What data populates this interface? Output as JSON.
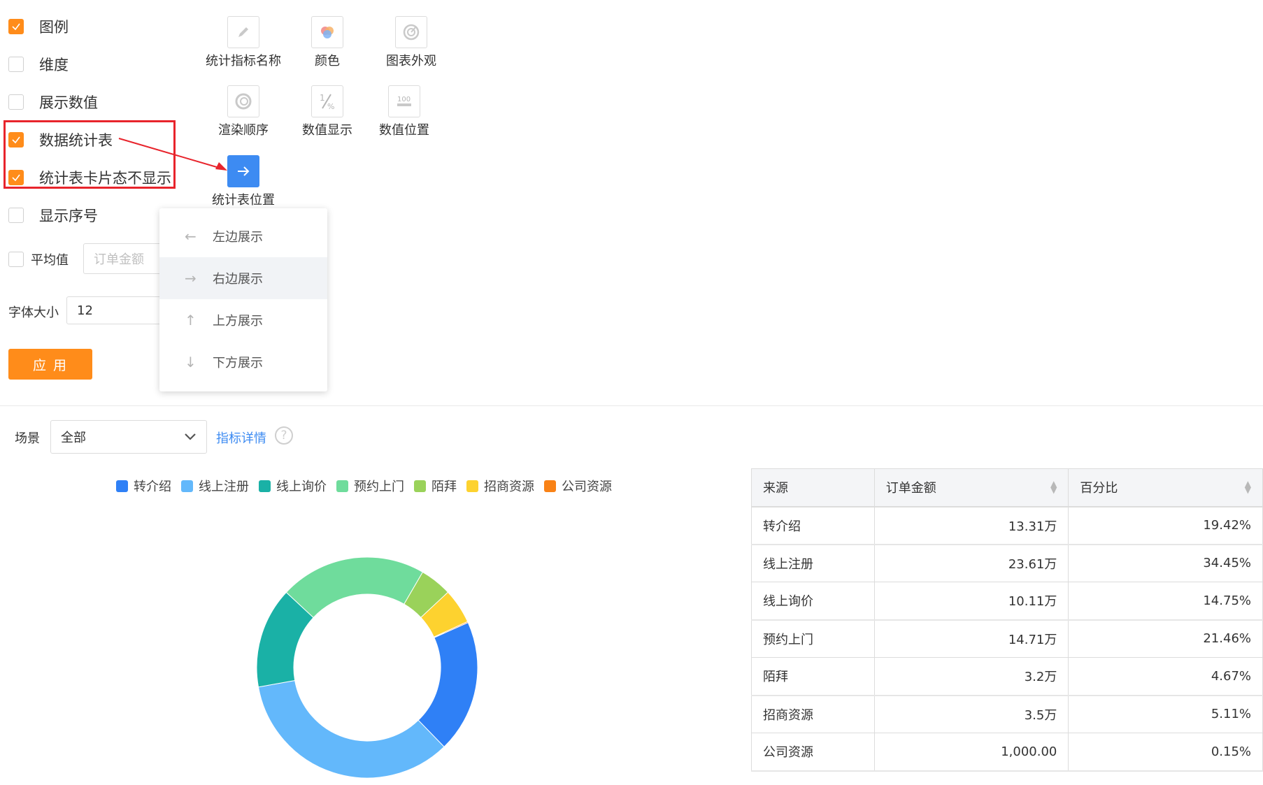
{
  "options": [
    {
      "label": "图例",
      "checked": true
    },
    {
      "label": "维度",
      "checked": false
    },
    {
      "label": "展示数值",
      "checked": false
    },
    {
      "label": "数据统计表",
      "checked": true
    },
    {
      "label": "统计表卡片态不显示",
      "checked": true
    },
    {
      "label": "显示序号",
      "checked": false
    }
  ],
  "average": {
    "label": "平均值",
    "checked": false,
    "placeholder": "订单金额"
  },
  "font_size": {
    "label": "字体大小",
    "value": "12"
  },
  "apply_label": "应 用",
  "tools": [
    {
      "label": "统计指标名称",
      "icon": "pencil-icon"
    },
    {
      "label": "颜色",
      "icon": "color-palette-icon"
    },
    {
      "label": "图表外观",
      "icon": "chart-appearance-icon"
    },
    {
      "label": "渲染顺序",
      "icon": "render-order-icon"
    },
    {
      "label": "数值显示",
      "icon": "percent-fraction-icon"
    },
    {
      "label": "数值位置",
      "icon": "value-position-icon"
    },
    {
      "label": "统计表位置",
      "icon": "arrow-right-icon"
    }
  ],
  "position_menu": [
    {
      "label": "左边展示",
      "icon": "arrow-left-icon",
      "glyph": "←"
    },
    {
      "label": "右边展示",
      "icon": "arrow-right-icon",
      "glyph": "→",
      "highlighted": true
    },
    {
      "label": "上方展示",
      "icon": "arrow-up-icon",
      "glyph": "↑"
    },
    {
      "label": "下方展示",
      "icon": "arrow-down-icon",
      "glyph": "↓"
    }
  ],
  "scene": {
    "label": "场景",
    "value": "全部",
    "details_link": "指标详情",
    "help": "?"
  },
  "colors": {
    "accent": "#ff8c1a",
    "highlight_box": "#e8242c",
    "link": "#3d8bf2"
  },
  "chart_data": {
    "type": "pie",
    "donut": true,
    "legend_position": "top",
    "categories": [
      "转介绍",
      "线上注册",
      "线上询价",
      "预约上门",
      "陌拜",
      "招商资源",
      "公司资源"
    ],
    "values": [
      19.42,
      34.45,
      14.75,
      21.46,
      4.67,
      5.11,
      0.15
    ],
    "colors": [
      "#2f80f6",
      "#63b8fb",
      "#1ab1a6",
      "#6fdc9c",
      "#9ad25a",
      "#fdd22f",
      "#f98216"
    ]
  },
  "table": {
    "headers": [
      "来源",
      "订单金额",
      "百分比"
    ],
    "rows": [
      [
        "转介绍",
        "13.31万",
        "19.42%"
      ],
      [
        "线上注册",
        "23.61万",
        "34.45%"
      ],
      [
        "线上询价",
        "10.11万",
        "14.75%"
      ],
      [
        "预约上门",
        "14.71万",
        "21.46%"
      ],
      [
        "陌拜",
        "3.2万",
        "4.67%"
      ],
      [
        "招商资源",
        "3.5万",
        "5.11%"
      ],
      [
        "公司资源",
        "1,000.00",
        "0.15%"
      ]
    ]
  }
}
